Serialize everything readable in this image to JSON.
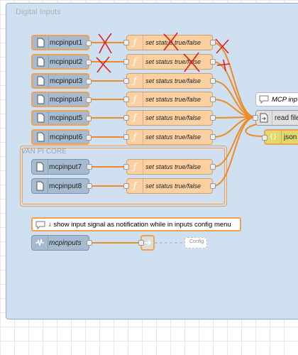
{
  "group": {
    "label": "Digital Inputs"
  },
  "subgroup": {
    "label": "VAN PI CORE"
  },
  "inputs": [
    {
      "label": "mcpinput1"
    },
    {
      "label": "mcpinput2"
    },
    {
      "label": "mcpinput3"
    },
    {
      "label": "mcpinput4"
    },
    {
      "label": "mcpinput5"
    },
    {
      "label": "mcpinput6"
    },
    {
      "label": "mcpinput7"
    },
    {
      "label": "mcpinput8"
    }
  ],
  "functions": [
    {
      "label": "set status true/false"
    },
    {
      "label": "set status true/false"
    },
    {
      "label": "set status true/false"
    },
    {
      "label": "set status true/false"
    },
    {
      "label": "set status true/false"
    },
    {
      "label": "set status true/false"
    },
    {
      "label": "set status true/false"
    },
    {
      "label": "set status true/false"
    }
  ],
  "right_nodes": {
    "comment": "MCP inp",
    "read_file": "read file",
    "json": "json"
  },
  "notice_comment": "↓ show input signal as notification while in inputs config menu",
  "mcpinputs_node": "mcpinputs",
  "config_node": "Config"
}
